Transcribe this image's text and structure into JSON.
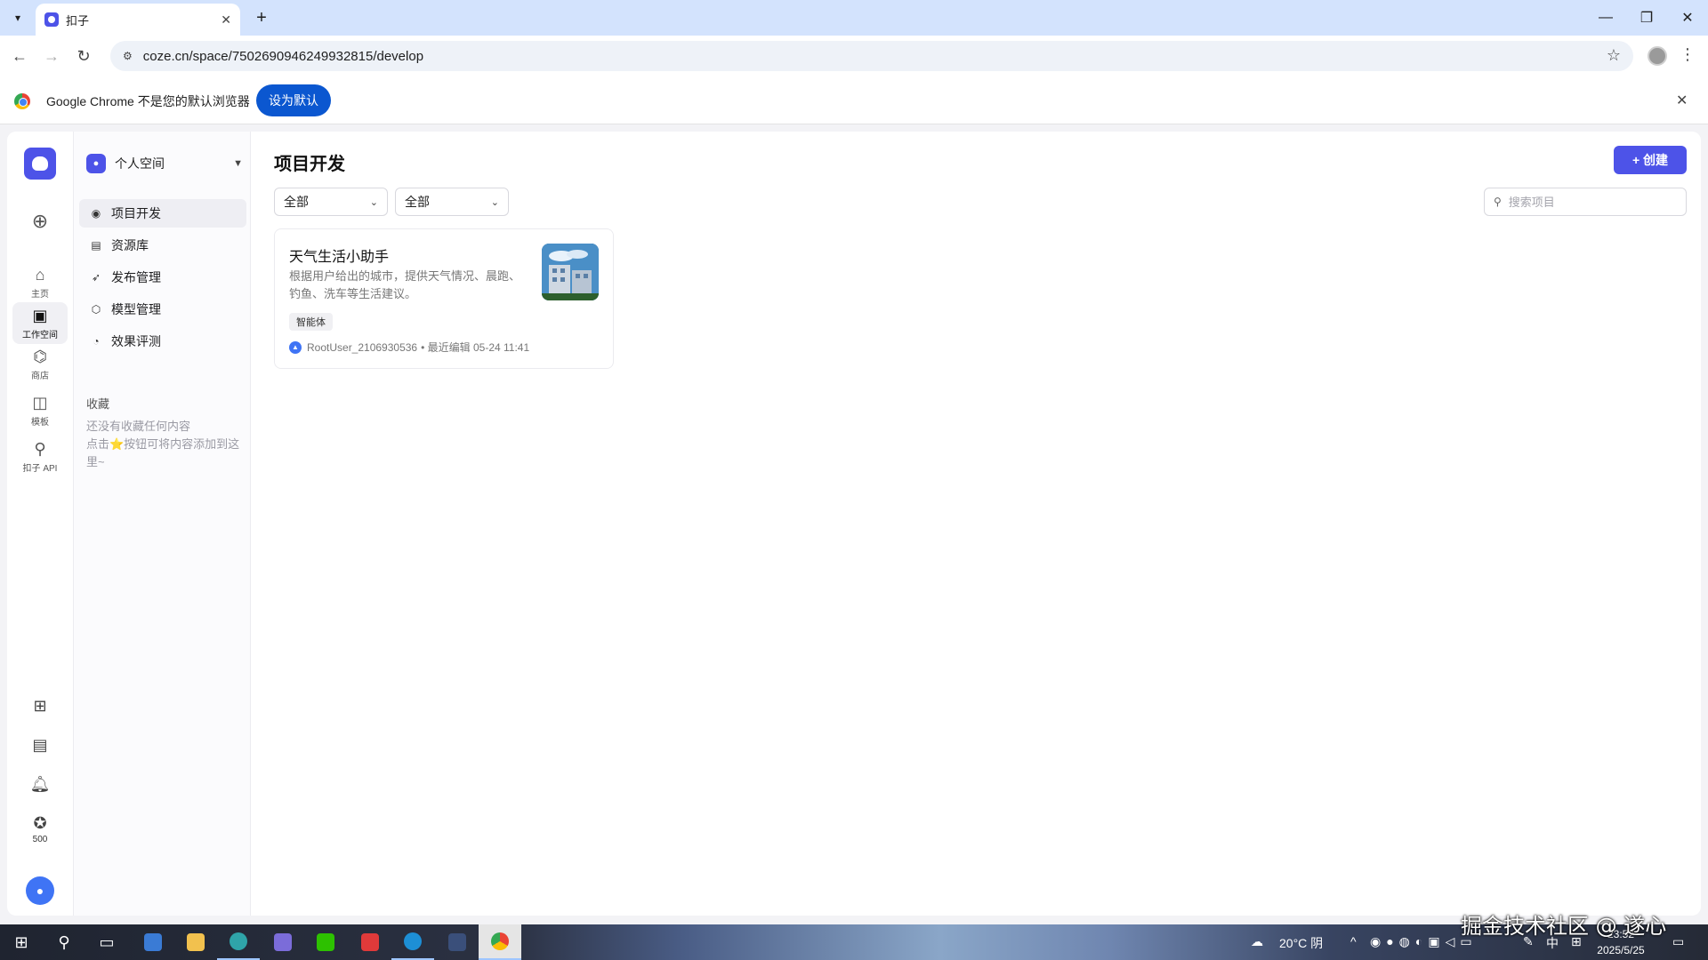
{
  "browser": {
    "tab_title": "扣子",
    "url": "coze.cn/space/7502690946249932815/develop",
    "infobar_text": "Google Chrome 不是您的默认浏览器",
    "infobar_button": "设为默认"
  },
  "rail": {
    "items": [
      {
        "label": "主页",
        "icon": "home-icon"
      },
      {
        "label": "工作空间",
        "icon": "terminal-icon"
      },
      {
        "label": "商店",
        "icon": "store-icon"
      },
      {
        "label": "模板",
        "icon": "template-icon"
      },
      {
        "label": "扣子 API",
        "icon": "api-icon"
      }
    ],
    "points": "500"
  },
  "sidebar": {
    "space_name": "个人空间",
    "nav": [
      {
        "label": "项目开发",
        "icon": "bot-icon"
      },
      {
        "label": "资源库",
        "icon": "library-icon"
      },
      {
        "label": "发布管理",
        "icon": "rocket-icon"
      },
      {
        "label": "模型管理",
        "icon": "model-icon"
      },
      {
        "label": "效果评测",
        "icon": "gauge-icon"
      }
    ],
    "favorites_title": "收藏",
    "favorites_empty": "还没有收藏任何内容",
    "favorites_hint": "点击⭐按钮可将内容添加到这里~"
  },
  "main": {
    "title": "项目开发",
    "create_label": "+ 创建",
    "filter1": "全部",
    "filter2": "全部",
    "search_placeholder": "搜索项目",
    "cards": [
      {
        "title": "天气生活小助手",
        "description": "根据用户给出的城市，提供天气情况、晨跑、钓鱼、洗车等生活建议。",
        "tag": "智能体",
        "author": "RootUser_2106930536",
        "edited": "• 最近编辑 05-24 11:41"
      }
    ]
  },
  "taskbar": {
    "weather": "20°C 阴",
    "ime": "中",
    "time": "23:52",
    "date": "2025/5/25"
  },
  "watermark": "掘金技术社区 @ 遂心"
}
